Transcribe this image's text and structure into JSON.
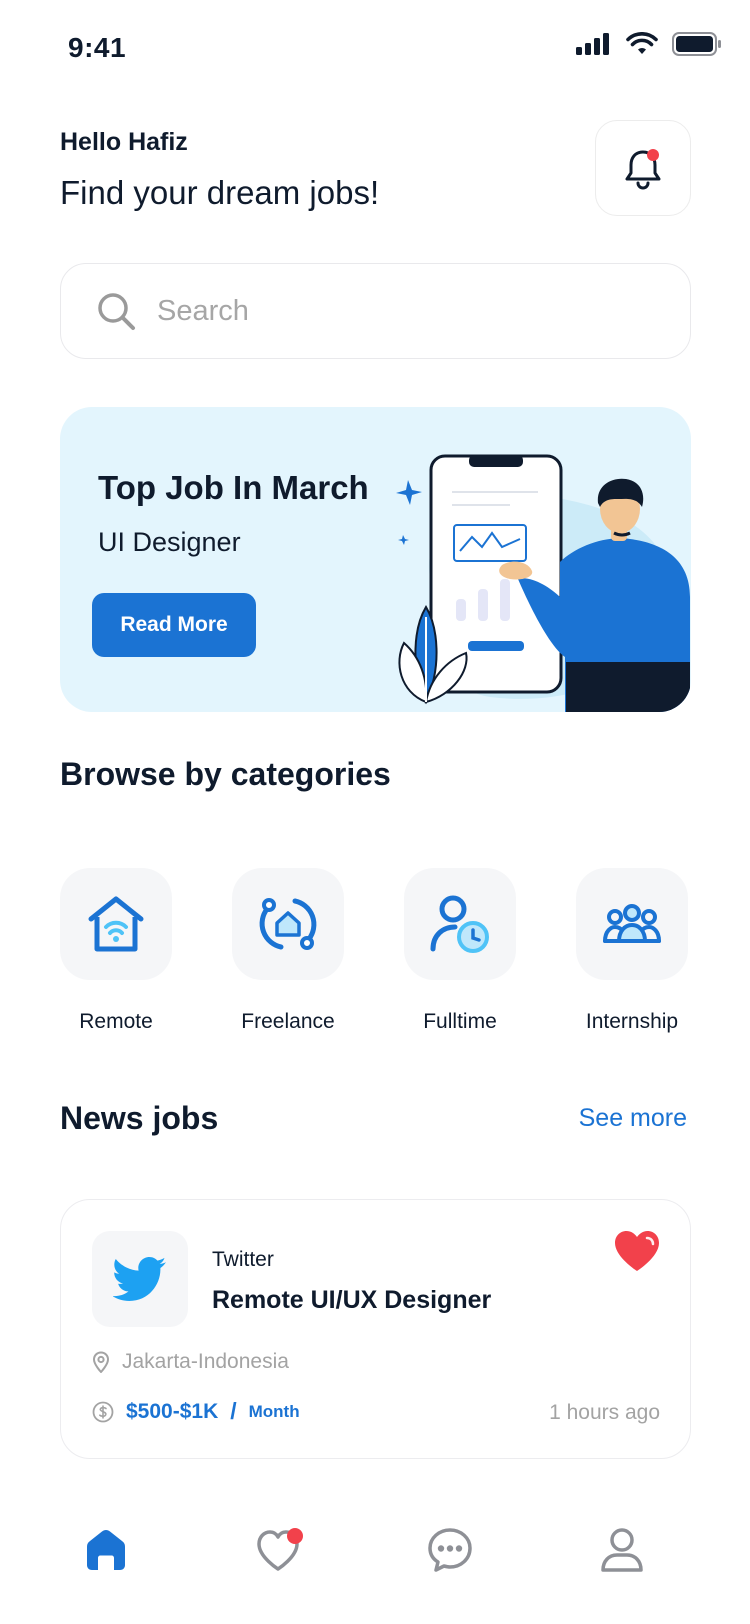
{
  "status_bar": {
    "time": "9:41"
  },
  "header": {
    "greeting": "Hello Hafiz",
    "headline": "Find your dream jobs!"
  },
  "search": {
    "placeholder": "Search"
  },
  "banner": {
    "title": "Top Job In March",
    "subtitle": "UI Designer",
    "button_label": "Read More"
  },
  "categories": {
    "title": "Browse by categories",
    "items": [
      {
        "label": "Remote",
        "icon": "home-wifi-icon"
      },
      {
        "label": "Freelance",
        "icon": "house-refresh-icon"
      },
      {
        "label": "Fulltime",
        "icon": "user-clock-icon"
      },
      {
        "label": "Internship",
        "icon": "group-icon"
      }
    ]
  },
  "news_jobs": {
    "title": "News jobs",
    "see_more": "See more",
    "jobs": [
      {
        "company": "Twitter",
        "title": "Remote UI/UX Designer",
        "location": "Jakarta-Indonesia",
        "salary": "$500-$1K",
        "salary_sep": "/",
        "salary_unit": "Month",
        "posted": "1 hours ago",
        "favorited": true
      }
    ]
  },
  "colors": {
    "accent": "#1b73d3",
    "heart": "#f2414b",
    "banner_bg": "#e3f5fd",
    "notification_dot": "#f2414b"
  },
  "bottom_nav": [
    {
      "name": "home",
      "icon": "home-icon",
      "active": true
    },
    {
      "name": "favorites",
      "icon": "heart-icon",
      "has_badge": true
    },
    {
      "name": "messages",
      "icon": "chat-icon"
    },
    {
      "name": "profile",
      "icon": "user-icon"
    }
  ]
}
